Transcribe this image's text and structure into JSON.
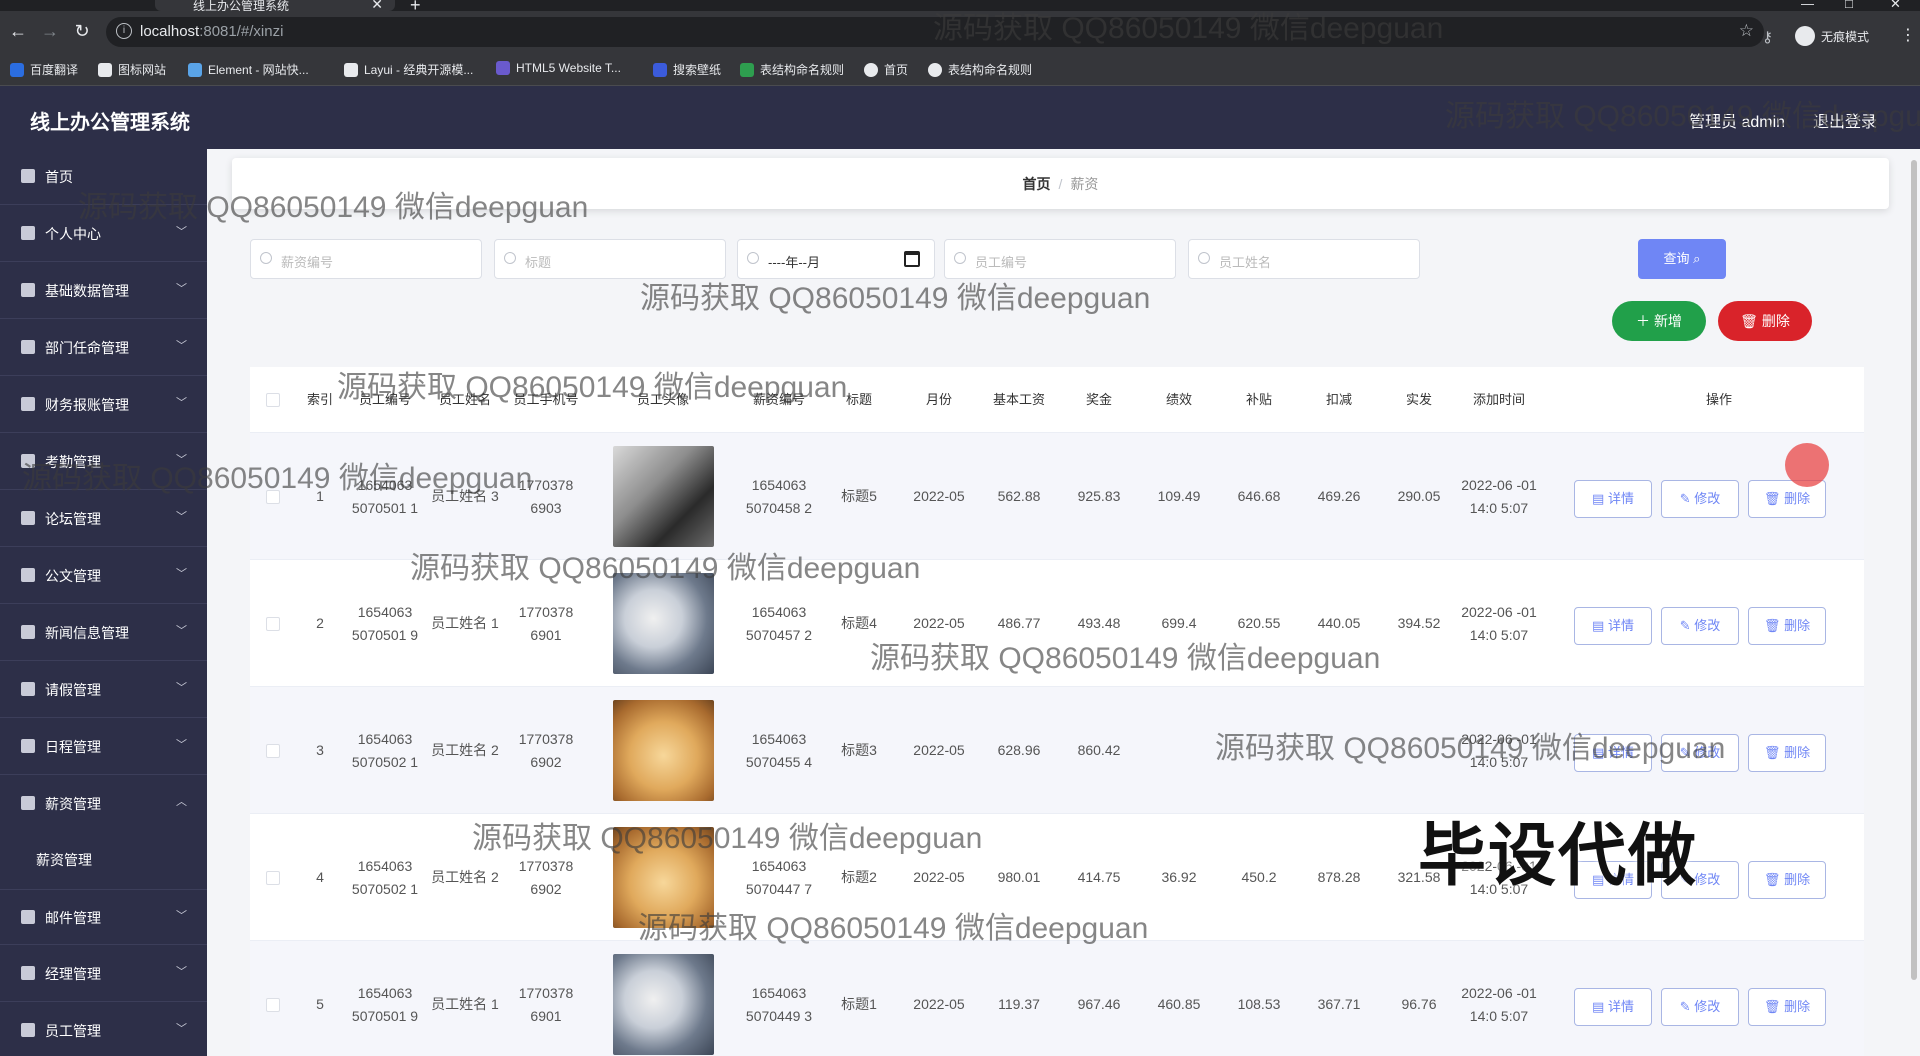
{
  "browser": {
    "tab_title": "线上办公管理系统",
    "url_host": "localhost",
    "url_path": ":8081/#/xinzi",
    "incognito_label": "无痕模式",
    "bookmarks": [
      "百度翻译",
      "图标网站",
      "Element - 网站快...",
      "Layui - 经典开源模...",
      "HTML5 Website T...",
      "搜索壁纸",
      "表结构命名规则",
      "首页",
      "表结构命名规则"
    ]
  },
  "header": {
    "title": "线上办公管理系统",
    "admin": "管理员 admin",
    "logout": "退出登录"
  },
  "sidebar": {
    "items": [
      {
        "label": "首页"
      },
      {
        "label": "个人中心"
      },
      {
        "label": "基础数据管理"
      },
      {
        "label": "部门任命管理"
      },
      {
        "label": "财务报账管理"
      },
      {
        "label": "考勤管理"
      },
      {
        "label": "论坛管理"
      },
      {
        "label": "公文管理"
      },
      {
        "label": "新闻信息管理"
      },
      {
        "label": "请假管理"
      },
      {
        "label": "日程管理"
      },
      {
        "label": "薪资管理"
      },
      {
        "label": "薪资管理"
      },
      {
        "label": "邮件管理"
      },
      {
        "label": "经理管理"
      },
      {
        "label": "员工管理"
      }
    ]
  },
  "breadcrumb": {
    "home": "首页",
    "current": "薪资"
  },
  "search": {
    "salary_no_placeholder": "薪资编号",
    "title_placeholder": "标题",
    "month_value": "----年--月",
    "emp_no_placeholder": "员工编号",
    "emp_name_placeholder": "员工姓名",
    "query_label": "查询"
  },
  "actions": {
    "add": "新增",
    "delete": "删除"
  },
  "table": {
    "headers": [
      "索引",
      "员工编号",
      "员工姓名",
      "员工手机号",
      "员工头像",
      "薪资编号",
      "标题",
      "月份",
      "基本工资",
      "奖金",
      "绩效",
      "补贴",
      "扣减",
      "实发",
      "添加时间",
      "操作"
    ],
    "op_labels": {
      "detail": "详情",
      "edit": "修改",
      "delete": "删除"
    },
    "rows": [
      {
        "idx": "1",
        "emp_no": "1654063 5070501 1",
        "emp_name": "员工姓名 3",
        "phone": "1770378 6903",
        "avatar": "man",
        "salary_no": "1654063 5070458 2",
        "title": "标题5",
        "month": "2022-05",
        "base": "562.88",
        "bonus": "925.83",
        "perf": "109.49",
        "allow": "646.68",
        "deduct": "469.26",
        "net": "290.05",
        "time": "2022-06 -01 14:0 5:07"
      },
      {
        "idx": "2",
        "emp_no": "1654063 5070501 9",
        "emp_name": "员工姓名 1",
        "phone": "1770378 6901",
        "avatar": "husky",
        "salary_no": "1654063 5070457 2",
        "title": "标题4",
        "month": "2022-05",
        "base": "486.77",
        "bonus": "493.48",
        "perf": "699.4",
        "allow": "620.55",
        "deduct": "440.05",
        "net": "394.52",
        "time": "2022-06 -01 14:0 5:07"
      },
      {
        "idx": "3",
        "emp_no": "1654063 5070502 1",
        "emp_name": "员工姓名 2",
        "phone": "1770378 6902",
        "avatar": "puppy",
        "salary_no": "1654063 5070455 4",
        "title": "标题3",
        "month": "2022-05",
        "base": "628.96",
        "bonus": "860.42",
        "perf": "",
        "allow": "",
        "deduct": "",
        "net": "",
        "time": "2022-06 -01 14:0 5:07"
      },
      {
        "idx": "4",
        "emp_no": "1654063 5070502 1",
        "emp_name": "员工姓名 2",
        "phone": "1770378 6902",
        "avatar": "puppy",
        "salary_no": "1654063 5070447 7",
        "title": "标题2",
        "month": "2022-05",
        "base": "980.01",
        "bonus": "414.75",
        "perf": "36.92",
        "allow": "450.2",
        "deduct": "878.28",
        "net": "321.58",
        "time": "2022-06 -01 14:0 5:07"
      },
      {
        "idx": "5",
        "emp_no": "1654063 5070501 9",
        "emp_name": "员工姓名 1",
        "phone": "1770378 6901",
        "avatar": "husky",
        "salary_no": "1654063 5070449 3",
        "title": "标题1",
        "month": "2022-05",
        "base": "119.37",
        "bonus": "967.46",
        "perf": "460.85",
        "allow": "108.53",
        "deduct": "367.71",
        "net": "96.76",
        "time": "2022-06 -01 14:0 5:07"
      }
    ]
  },
  "overlays": {
    "watermark": "源码获取 QQ86050149 微信deepguan",
    "stamp": "毕设代做"
  },
  "colors": {
    "sidebar_bg": "#2d2f48",
    "query_btn": "#6f86f5",
    "add_btn": "#21a04a",
    "delete_btn": "#d9232a"
  }
}
